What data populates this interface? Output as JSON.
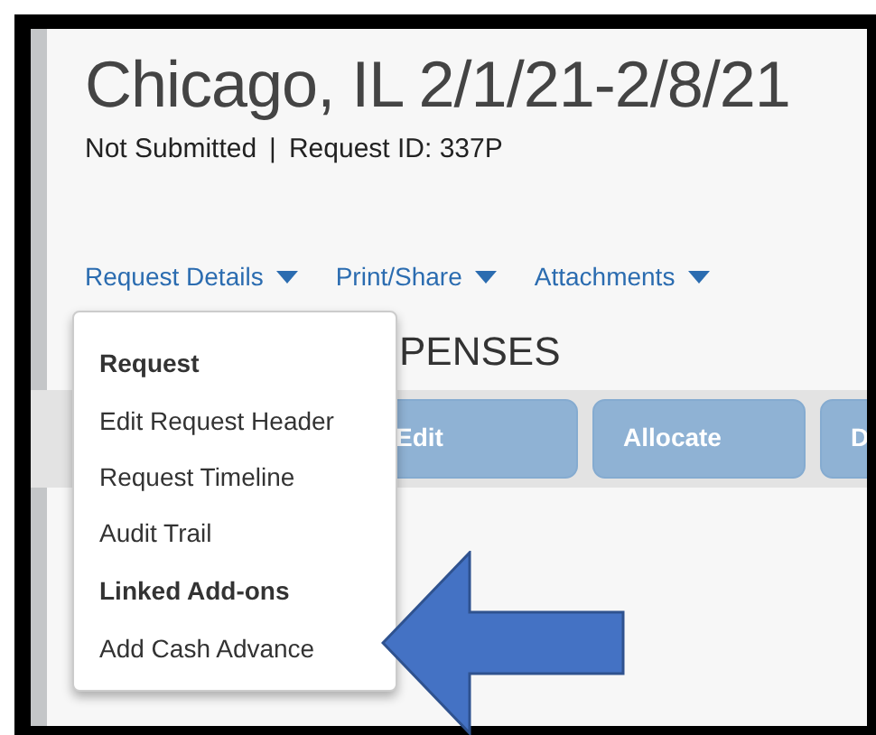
{
  "header": {
    "title": "Chicago, IL 2/1/21-2/8/21",
    "status": "Not Submitted",
    "separator": "|",
    "request_id": "Request ID: 337P"
  },
  "nav": [
    {
      "label": "Request Details"
    },
    {
      "label": "Print/Share"
    },
    {
      "label": "Attachments"
    }
  ],
  "section": {
    "heading": "PENSES",
    "buttons": [
      "Edit",
      "Allocate",
      "D"
    ]
  },
  "menu": [
    {
      "kind": "header",
      "label": "Request"
    },
    {
      "kind": "item",
      "label": "Edit Request Header"
    },
    {
      "kind": "item",
      "label": "Request Timeline"
    },
    {
      "kind": "item",
      "label": "Audit Trail"
    },
    {
      "kind": "header",
      "label": "Linked Add-ons"
    },
    {
      "kind": "item",
      "label": "Add Cash Advance"
    }
  ]
}
